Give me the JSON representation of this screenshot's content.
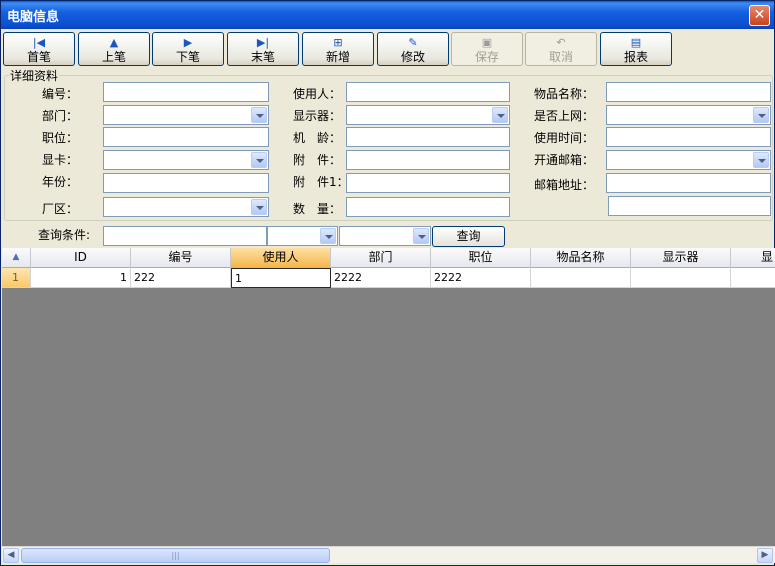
{
  "window": {
    "title": "电脑信息",
    "close_glyph": "✕"
  },
  "toolbar": [
    {
      "label": "首笔",
      "icon": "first-record-icon",
      "glyph": "|◀",
      "enabled": true
    },
    {
      "label": "上笔",
      "icon": "prev-record-icon",
      "glyph": "▲",
      "enabled": true
    },
    {
      "label": "下笔",
      "icon": "next-record-icon",
      "glyph": "▶",
      "enabled": true
    },
    {
      "label": "末笔",
      "icon": "last-record-icon",
      "glyph": "▶|",
      "enabled": true
    },
    {
      "label": "新增",
      "icon": "add-icon",
      "glyph": "⊞",
      "enabled": true
    },
    {
      "label": "修改",
      "icon": "edit-icon",
      "glyph": "✎",
      "enabled": true
    },
    {
      "label": "保存",
      "icon": "save-icon",
      "glyph": "▣",
      "enabled": false
    },
    {
      "label": "取消",
      "icon": "undo-icon",
      "glyph": "↶",
      "enabled": false
    },
    {
      "label": "报表",
      "icon": "report-icon",
      "glyph": "▤",
      "enabled": true
    }
  ],
  "details": {
    "legend": "详细资料",
    "col1": [
      {
        "label": "编号：",
        "value": ""
      },
      {
        "label": "部门：",
        "value": ""
      },
      {
        "label": "职位：",
        "value": ""
      },
      {
        "label": "显卡：",
        "value": ""
      },
      {
        "label": "年份：",
        "value": ""
      },
      {
        "label": "厂区：",
        "value": ""
      }
    ],
    "col2": [
      {
        "label": "使用人：",
        "value": ""
      },
      {
        "label": "显示器：",
        "value": ""
      },
      {
        "label": "机　龄：",
        "value": ""
      },
      {
        "label": "附　件：",
        "value": ""
      },
      {
        "label": "附　件1：",
        "value": ""
      },
      {
        "label": "数　量：",
        "value": ""
      }
    ],
    "col3": [
      {
        "label": "物品名称：",
        "value": ""
      },
      {
        "label": "是否上网：",
        "value": ""
      },
      {
        "label": "使用时间：",
        "value": ""
      },
      {
        "label": "开通邮箱：",
        "value": ""
      },
      {
        "label": "邮箱地址：",
        "value": ""
      },
      {
        "label": "",
        "value": ""
      }
    ]
  },
  "query": {
    "label": "查询条件:",
    "button": "查询",
    "text": "",
    "field": "",
    "operator": ""
  },
  "grid": {
    "columns": [
      "ID",
      "编号",
      "使用人",
      "部门",
      "职位",
      "物品名称",
      "显示器",
      "显"
    ],
    "active_column": 2,
    "rows": [
      {
        "row_no": "1",
        "cells": [
          "1",
          "222",
          "1",
          "2222",
          "2222",
          "",
          "",
          ""
        ]
      }
    ]
  },
  "scrollbar": {
    "left": "◀",
    "right": "▶",
    "grip": "|||"
  }
}
